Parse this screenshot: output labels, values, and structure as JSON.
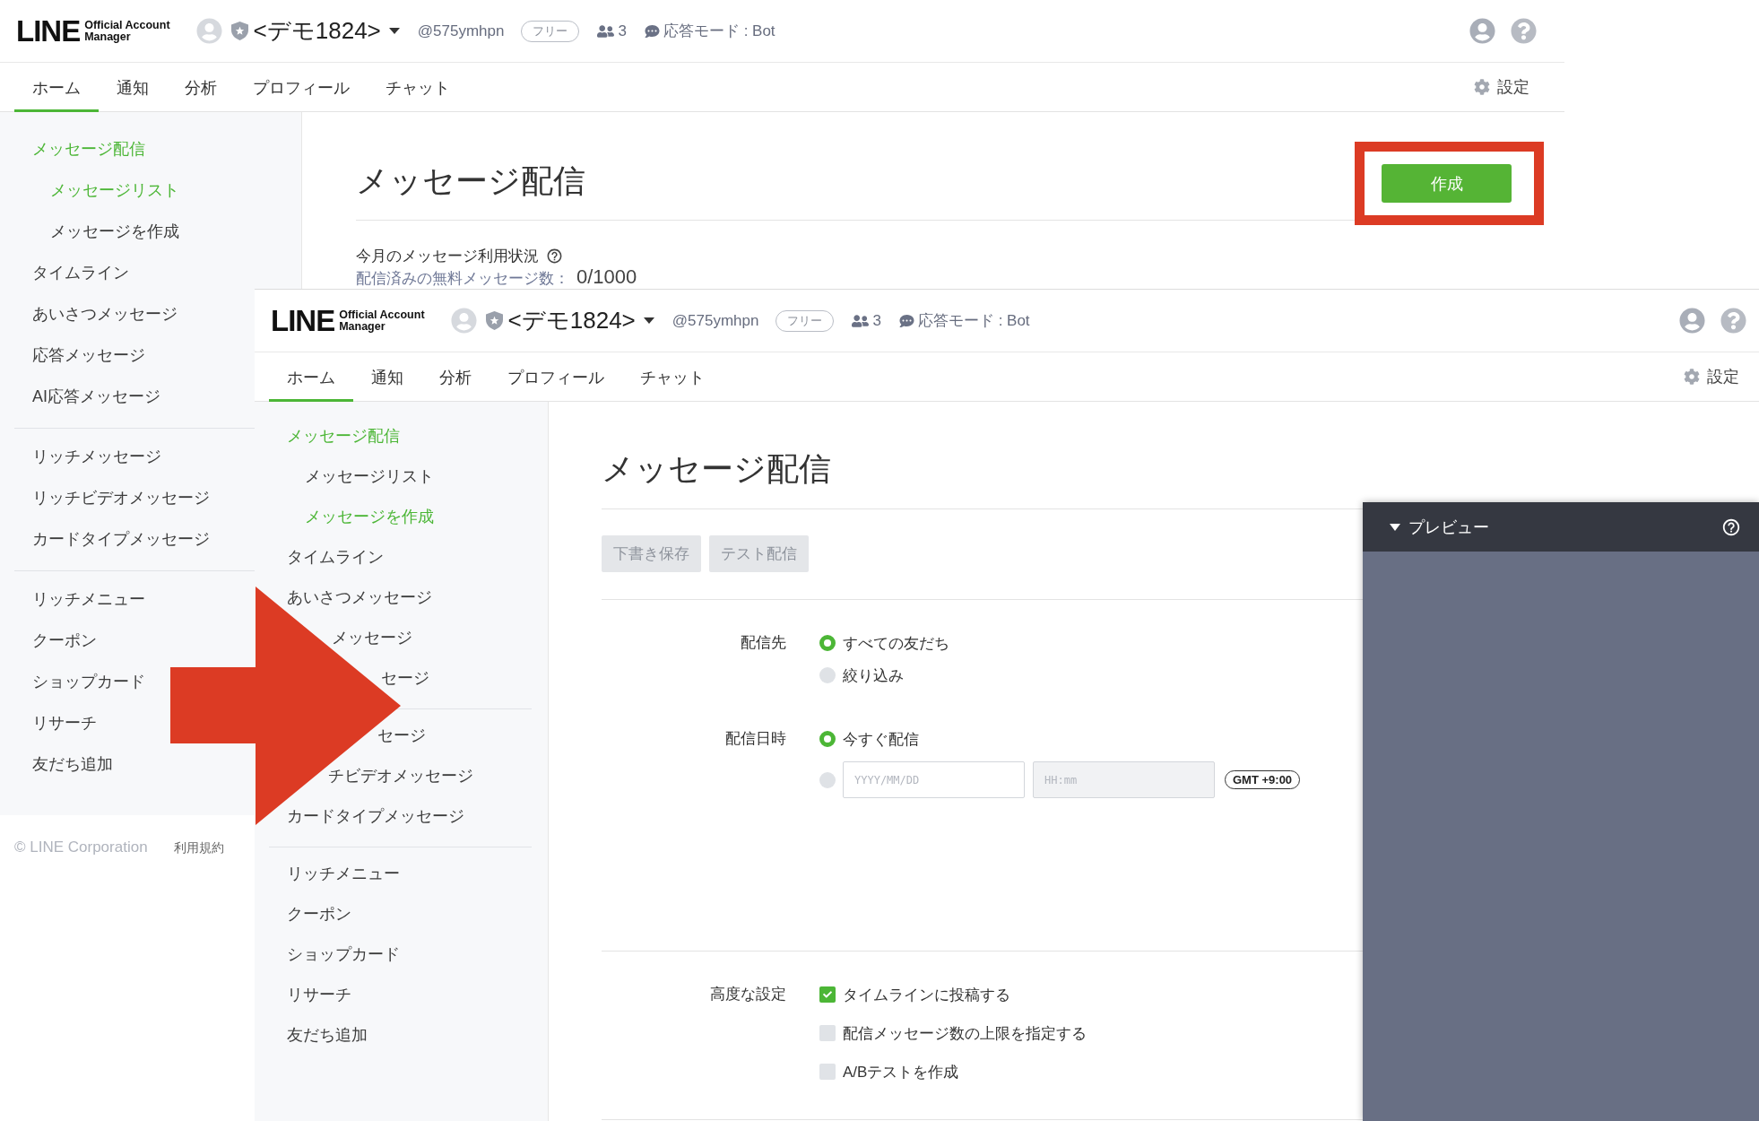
{
  "back_screenshot": {
    "header": {
      "logo": {
        "wordmark": "LINE",
        "line_1": "Official Account",
        "line_2": "Manager"
      },
      "account_name": "<デモ1824>",
      "account_id": "@575ymhpn",
      "plan_badge": "フリー",
      "friend_count": "3",
      "response_mode": "応答モード : Bot"
    },
    "tabs": [
      {
        "label": "ホーム",
        "selected": true
      },
      {
        "label": "通知",
        "selected": false
      },
      {
        "label": "分析",
        "selected": false
      },
      {
        "label": "プロフィール",
        "selected": false
      },
      {
        "label": "チャット",
        "selected": false
      }
    ],
    "settings": "設定",
    "sidebar": {
      "groups": [
        {
          "items": [
            {
              "kind": "link",
              "label": "メッセージ配信",
              "selected": true,
              "children": [
                {
                  "label": "メッセージリスト",
                  "selected": true
                },
                {
                  "label": "メッセージを作成",
                  "selected": false
                }
              ]
            },
            {
              "kind": "link",
              "label": "タイムライン",
              "selected": false
            },
            {
              "kind": "link",
              "label": "あいさつメッセージ",
              "selected": false
            },
            {
              "kind": "link",
              "label": "応答メッセージ",
              "selected": false
            },
            {
              "kind": "link",
              "label": "AI応答メッセージ",
              "selected": false
            }
          ]
        },
        {
          "items": [
            {
              "kind": "link",
              "label": "リッチメッセージ",
              "selected": false
            },
            {
              "kind": "link",
              "label": "リッチビデオメッセージ",
              "selected": false
            },
            {
              "kind": "link",
              "label": "カードタイプメッセージ",
              "selected": false
            }
          ]
        },
        {
          "items": [
            {
              "kind": "link",
              "label": "リッチメニュー",
              "selected": false
            },
            {
              "kind": "link",
              "label": "クーポン",
              "selected": false
            },
            {
              "kind": "link",
              "label": "ショップカード",
              "selected": false
            },
            {
              "kind": "link",
              "label": "リサーチ",
              "selected": false
            },
            {
              "kind": "link",
              "label": "友だち追加",
              "selected": false
            }
          ]
        }
      ]
    },
    "footer": {
      "copyright": "© LINE Corporation",
      "terms": "利用規約"
    },
    "main": {
      "title": "メッセージ配信",
      "create_button": {
        "label": "作成",
        "highlighted": true
      },
      "usage": {
        "title": "今月のメッセージ利用状況",
        "label": "配信済みの無料メッセージ数：",
        "value": "0/1000"
      }
    }
  },
  "front_screenshot": {
    "header": {
      "logo": {
        "wordmark": "LINE",
        "line_1": "Official Account",
        "line_2": "Manager"
      },
      "account_name": "<デモ1824>",
      "account_id": "@575ymhpn",
      "plan_badge": "フリー",
      "friend_count": "3",
      "response_mode": "応答モード : Bot"
    },
    "tabs": [
      {
        "label": "ホーム",
        "selected": true
      },
      {
        "label": "通知",
        "selected": false
      },
      {
        "label": "分析",
        "selected": false
      },
      {
        "label": "プロフィール",
        "selected": false
      },
      {
        "label": "チャット",
        "selected": false
      }
    ],
    "settings": "設定",
    "sidebar": {
      "groups": [
        {
          "items": [
            {
              "kind": "link",
              "label": "メッセージ配信",
              "selected": true,
              "children": [
                {
                  "label": "メッセージリスト",
                  "selected": false
                },
                {
                  "label": "メッセージを作成",
                  "selected": true
                }
              ]
            },
            {
              "kind": "link",
              "label": "タイムライン",
              "selected": false
            },
            {
              "kind": "link",
              "label": "あいさつメッセージ",
              "selected": false
            },
            {
              "kind": "clipped",
              "label": "メッセージ",
              "selected": false
            },
            {
              "kind": "clipped",
              "label": "セージ",
              "selected": false
            }
          ]
        },
        {
          "items": [
            {
              "kind": "clipped",
              "label": "セージ",
              "selected": false
            },
            {
              "kind": "clipped",
              "label": "チビデオメッセージ",
              "selected": false
            },
            {
              "kind": "link",
              "label": "カードタイプメッセージ",
              "selected": false
            }
          ]
        },
        {
          "items": [
            {
              "kind": "link",
              "label": "リッチメニュー",
              "selected": false
            },
            {
              "kind": "link",
              "label": "クーポン",
              "selected": false
            },
            {
              "kind": "link",
              "label": "ショップカード",
              "selected": false
            },
            {
              "kind": "link",
              "label": "リサーチ",
              "selected": false
            },
            {
              "kind": "link",
              "label": "友だち追加",
              "selected": false
            }
          ]
        }
      ]
    },
    "main": {
      "title": "メッセージ配信",
      "actions": [
        {
          "label": "下書き保存",
          "disabled": true
        },
        {
          "label": "テスト配信",
          "disabled": true
        }
      ],
      "form_groups": [
        {
          "fields": [
            {
              "kind": "radio",
              "label": "配信先",
              "options": [
                {
                  "kind": "choice",
                  "label": "すべての友だち",
                  "selected": true
                },
                {
                  "kind": "choice",
                  "label": "絞り込み",
                  "selected": false
                }
              ]
            },
            {
              "kind": "radio",
              "label": "配信日時",
              "options": [
                {
                  "kind": "choice",
                  "label": "今すぐ配信",
                  "selected": true
                },
                {
                  "kind": "schedule",
                  "selected": false,
                  "date": {
                    "placeholder": "YYYY/MM/DD",
                    "disabled": false
                  },
                  "time": {
                    "placeholder": "HH:mm",
                    "disabled": true
                  },
                  "timezone": "GMT +9:00"
                }
              ]
            }
          ]
        },
        {
          "fields": [
            {
              "kind": "checkbox",
              "label": "高度な設定",
              "options": [
                {
                  "label": "タイムラインに投稿する",
                  "checked": true
                },
                {
                  "label": "配信メッセージ数の上限を指定する",
                  "checked": false
                },
                {
                  "label": "A/Bテストを作成",
                  "checked": false
                }
              ]
            }
          ]
        }
      ]
    },
    "preview": {
      "title": "プレビュー",
      "expanded": true
    }
  }
}
